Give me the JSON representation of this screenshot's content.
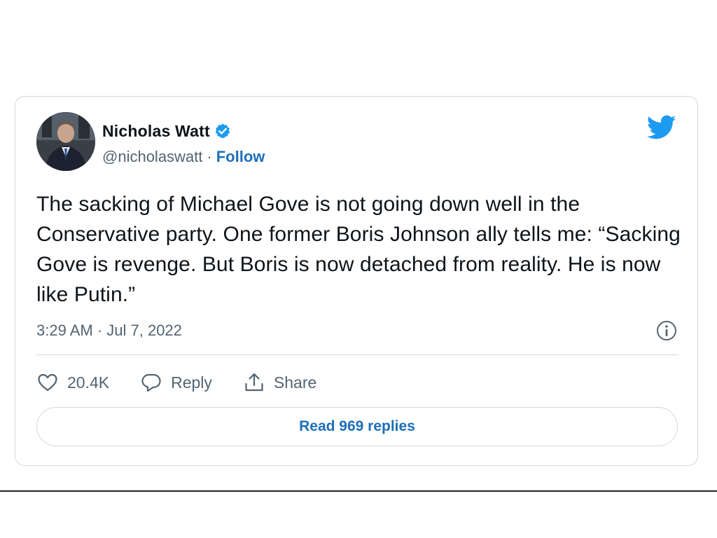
{
  "author": {
    "display_name": "Nicholas Watt",
    "handle": "@nicholaswatt",
    "separator": "·",
    "follow_label": "Follow",
    "verified": true
  },
  "tweet": {
    "text": "The sacking of Michael Gove is not going down well in the Conservative party. One former Boris Johnson ally tells me: “Sacking Gove is revenge. But Boris is now detached from reality. He is now like Putin.”",
    "timestamp": "3:29 AM · Jul 7, 2022"
  },
  "actions": {
    "like_count": "20.4K",
    "reply_label": "Reply",
    "share_label": "Share"
  },
  "read_replies_label": "Read 969 replies",
  "icons": {
    "brand": "twitter-bird-icon",
    "verified": "verified-badge-icon",
    "info": "info-icon",
    "like": "heart-icon",
    "reply": "speech-bubble-icon",
    "share": "share-upload-icon"
  },
  "colors": {
    "twitter_blue": "#1d9bf0",
    "link_blue": "#1d6fb8",
    "text_primary": "#0f1419",
    "text_secondary": "#536471",
    "border": "#cfd9de"
  }
}
